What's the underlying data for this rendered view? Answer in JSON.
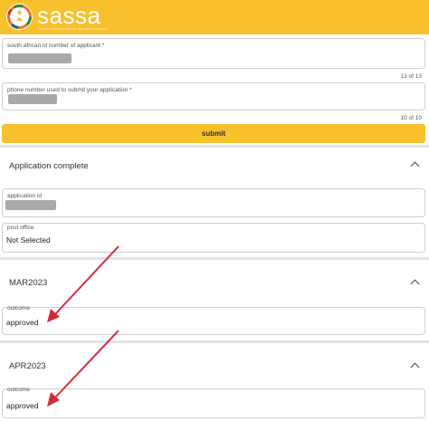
{
  "header": {
    "brand": "sassa",
    "brand_sub": "SOUTH AFRICAN SOCIAL SECURITY AGENCY",
    "color": "#f8c12b"
  },
  "form": {
    "id_field": {
      "label": "south african id number of applicant *",
      "counter": "13 of 13"
    },
    "phone_field": {
      "label": "phone number used to submit your application *",
      "counter": "10 of 10"
    },
    "submit_label": "submit"
  },
  "application": {
    "title": "Application complete",
    "application_id_label": "application id",
    "post_office_label": "post office",
    "post_office_value": "Not Selected"
  },
  "months": [
    {
      "title": "MAR2023",
      "outcome_label": "outcome",
      "outcome_value": "approved"
    },
    {
      "title": "APR2023",
      "outcome_label": "outcome",
      "outcome_value": "approved"
    }
  ],
  "annotation_color": "#d42a3a"
}
